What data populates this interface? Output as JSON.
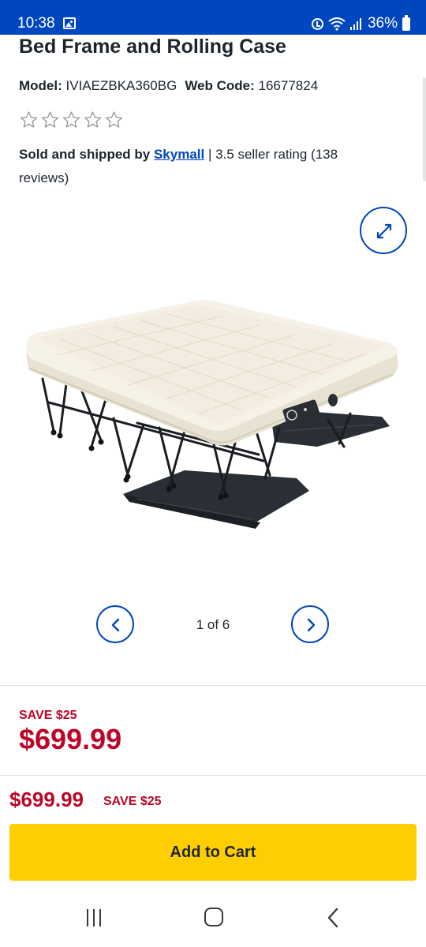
{
  "status_bar": {
    "time": "10:38",
    "battery": "36%",
    "background": "#0046be",
    "icons": [
      "gallery-icon",
      "alarm-icon",
      "wifi-icon",
      "signal-icon",
      "battery-icon"
    ]
  },
  "product": {
    "title": "Bed Frame and Rolling Case",
    "model_label": "Model:",
    "model_value": "IVIAEZBKA360BG",
    "webcode_label": "Web Code:",
    "webcode_value": "16677824",
    "rating_stars": 0,
    "rating_max": 5,
    "seller_prefix": "Sold and shipped by",
    "seller_name": "Skymall",
    "seller_suffix": " | 3.5 seller rating (138 reviews)"
  },
  "gallery": {
    "counter": "1 of 6",
    "expand_icon": "expand-icon",
    "prev_icon": "chevron-left-icon",
    "next_icon": "chevron-right-icon"
  },
  "pricing": {
    "save_label": "SAVE $25",
    "price": "$699.99"
  },
  "sticky_bar": {
    "price": "$699.99",
    "save_label": "SAVE $25",
    "add_to_cart_label": "Add to Cart"
  },
  "colors": {
    "brand_blue": "#0046be",
    "sale_red": "#bb0628",
    "cta_yellow": "#ffce00",
    "text_dark": "#1d252c"
  }
}
